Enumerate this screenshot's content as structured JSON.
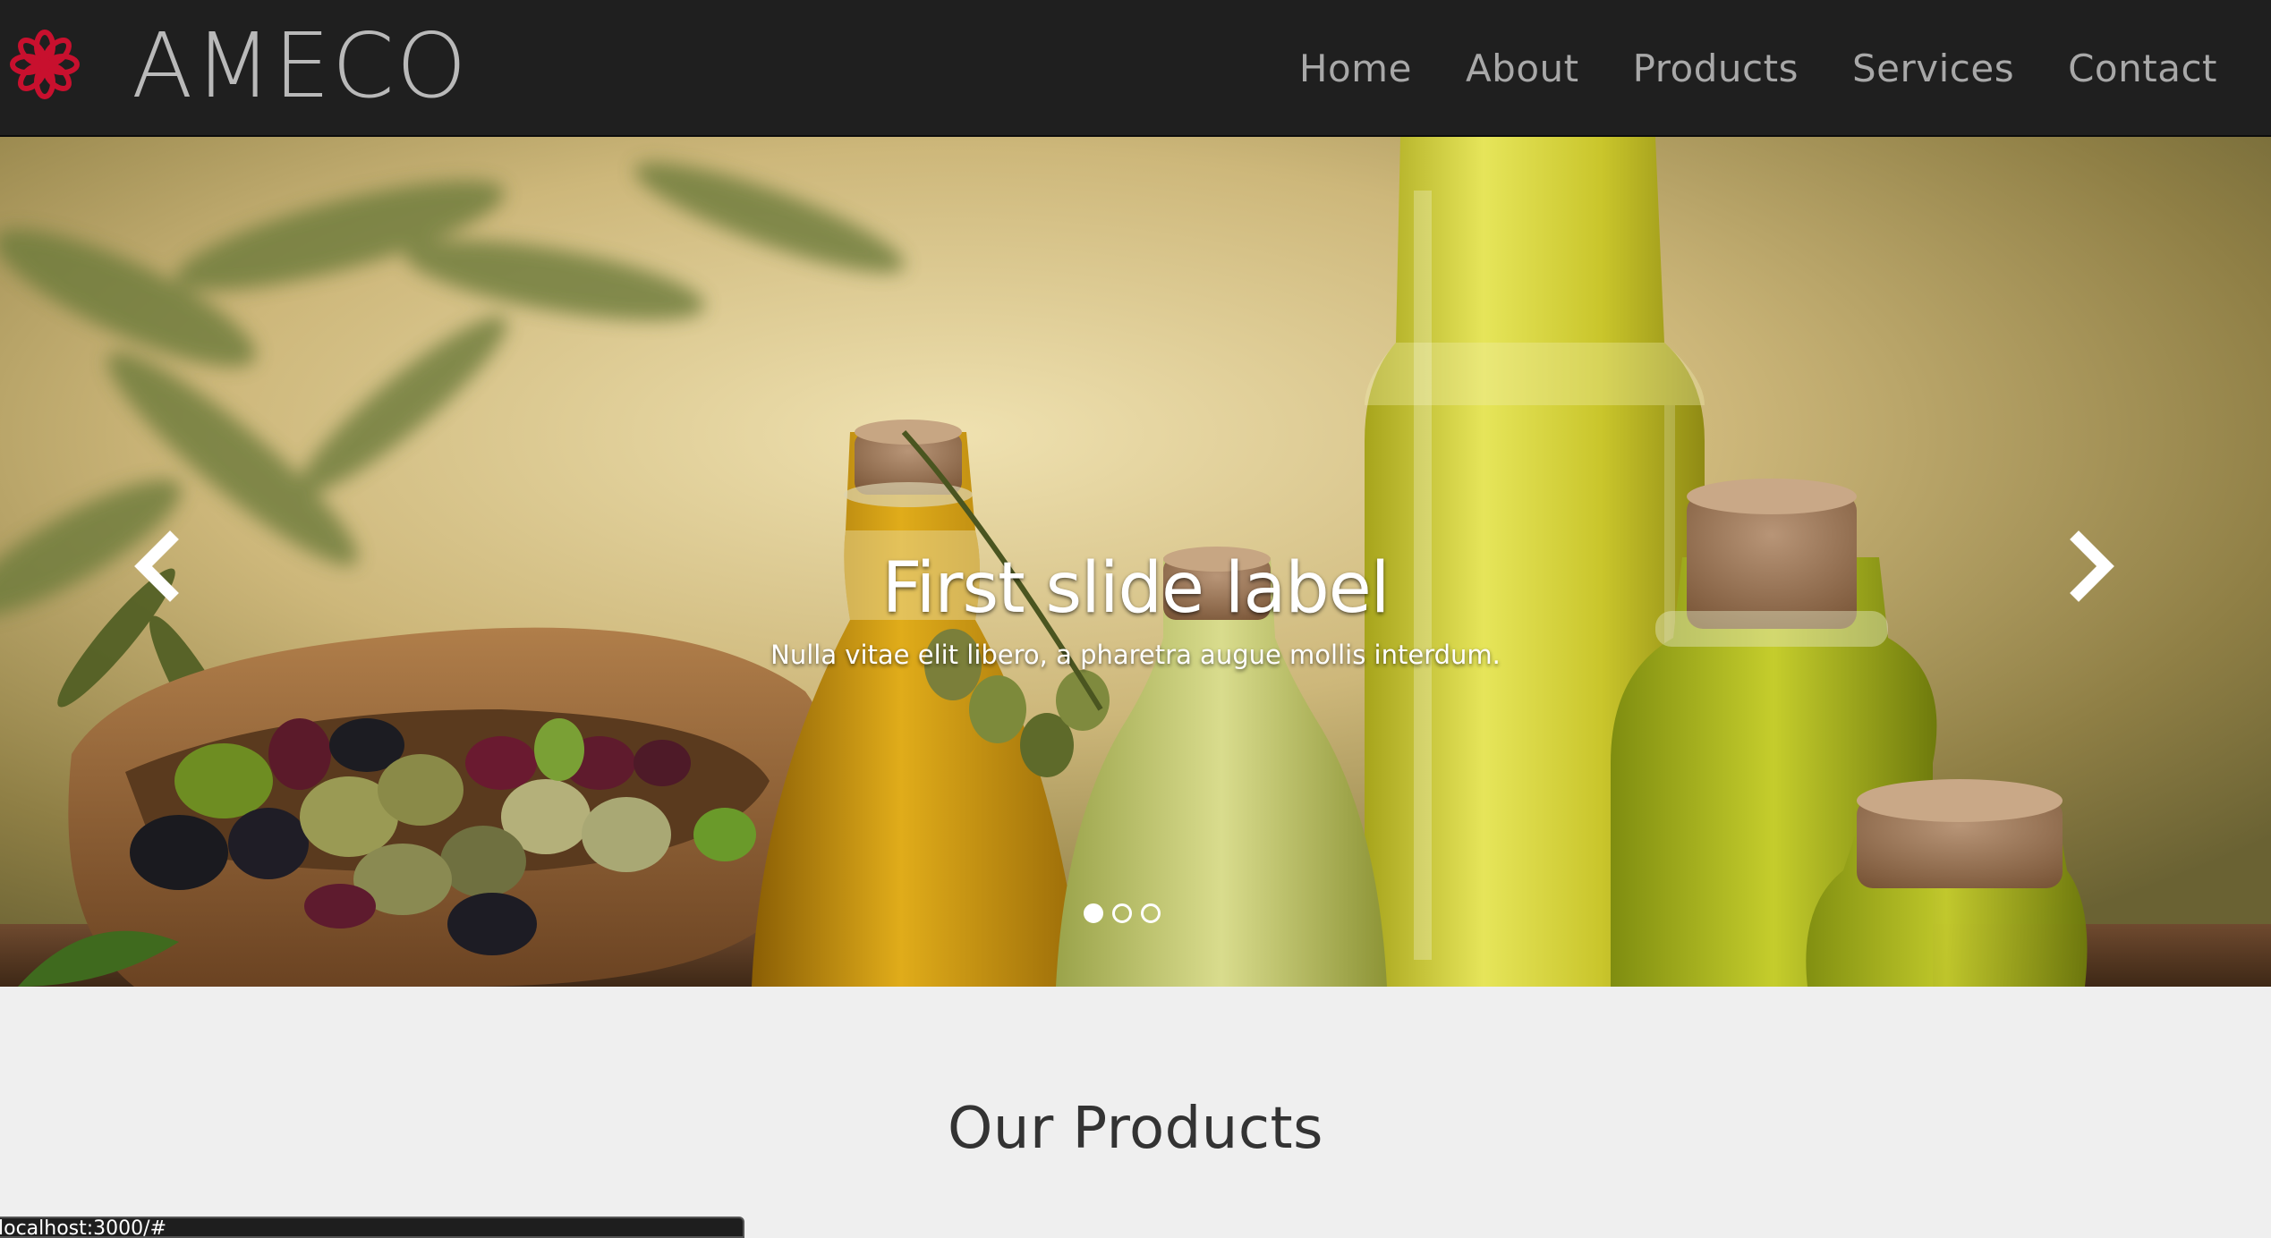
{
  "header": {
    "brand_name": "AMECO",
    "brand_icon": "flower-icon",
    "brand_icon_color": "#c8102e",
    "background": "#1f1f1f",
    "nav": [
      {
        "label": "Home"
      },
      {
        "label": "About"
      },
      {
        "label": "Products"
      },
      {
        "label": "Services"
      },
      {
        "label": "Contact"
      }
    ]
  },
  "carousel": {
    "slide_title": "First slide label",
    "slide_text": "Nulla vitae elit libero, a pharetra augue mollis interdum.",
    "prev_icon": "chevron-left-icon",
    "next_icon": "chevron-right-icon",
    "slide_count": 3,
    "active_index": 0
  },
  "products": {
    "title": "Our Products"
  },
  "status_bar": {
    "text": "localhost:3000/#"
  }
}
